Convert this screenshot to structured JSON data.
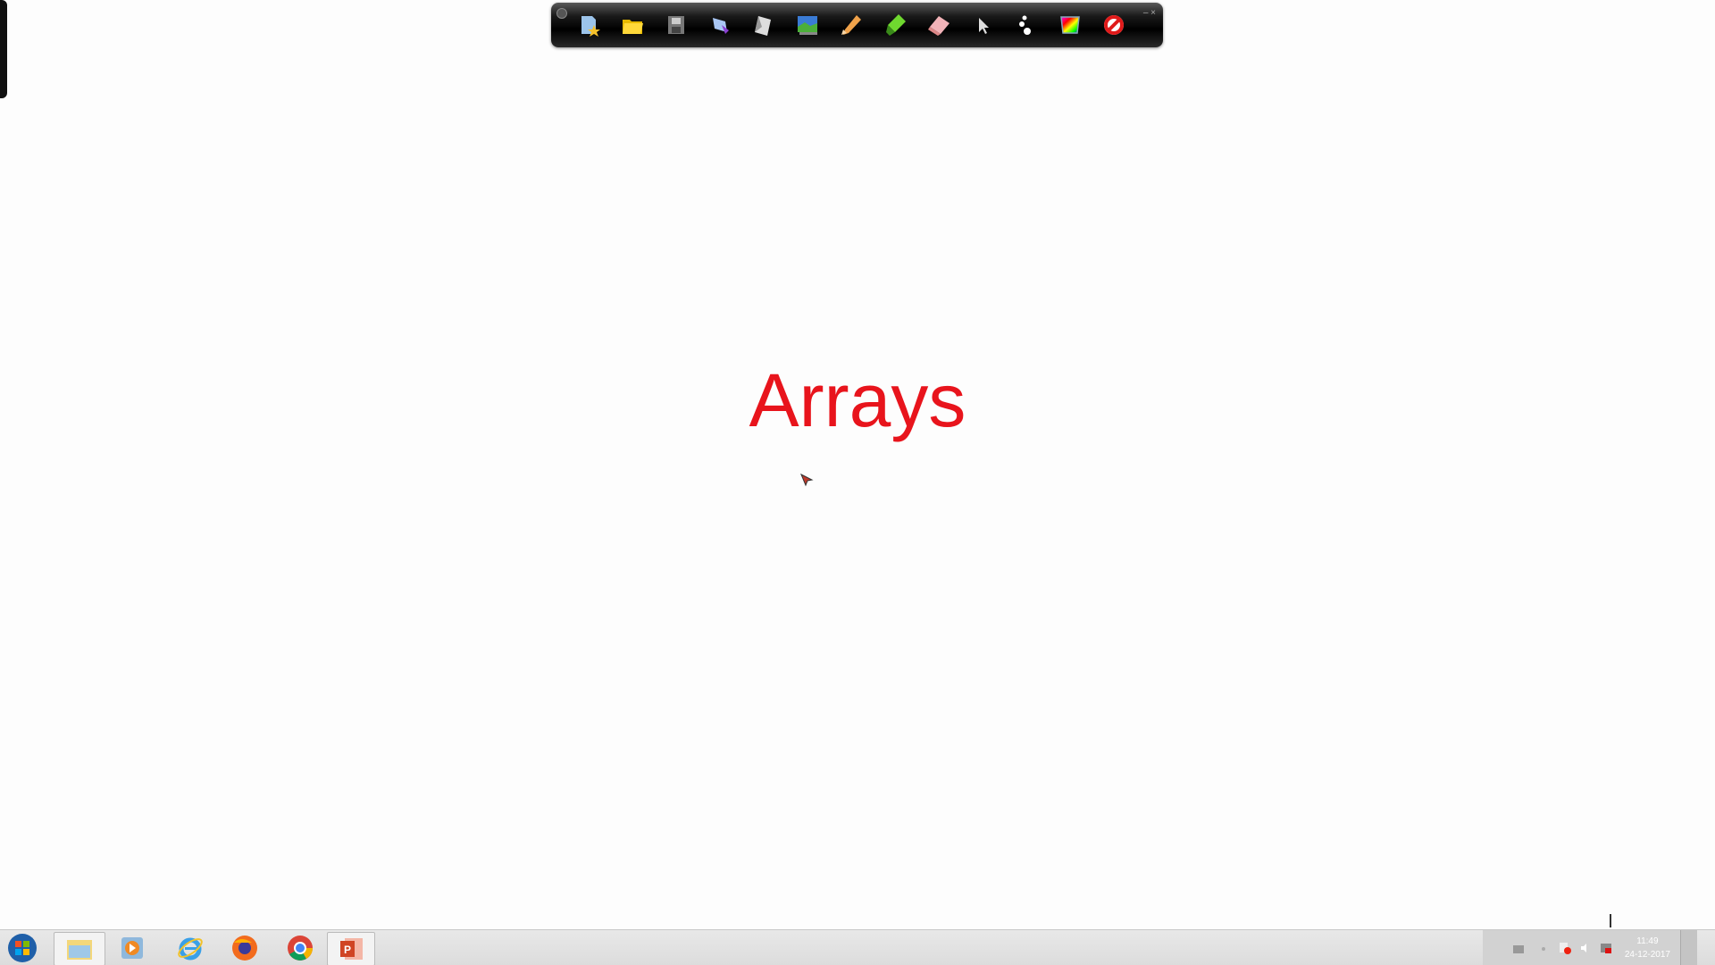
{
  "slide": {
    "title": "Arrays",
    "title_color": "#e8141c"
  },
  "toolbar": {
    "tools": [
      "new-page-icon",
      "open-folder-icon",
      "save-disk-icon",
      "pen-tool-icon",
      "paper-icon",
      "image-icon",
      "pencil-icon",
      "highlighter-icon",
      "eraser-icon",
      "pointer-icon",
      "spotlight-icon",
      "color-palette-icon",
      "stop-icon"
    ]
  },
  "taskbar": {
    "apps": [
      "file-explorer",
      "media-player",
      "internet-explorer",
      "firefox",
      "chrome",
      "powerpoint"
    ],
    "clock": {
      "time": "11:49",
      "date": "24-12-2017"
    }
  }
}
